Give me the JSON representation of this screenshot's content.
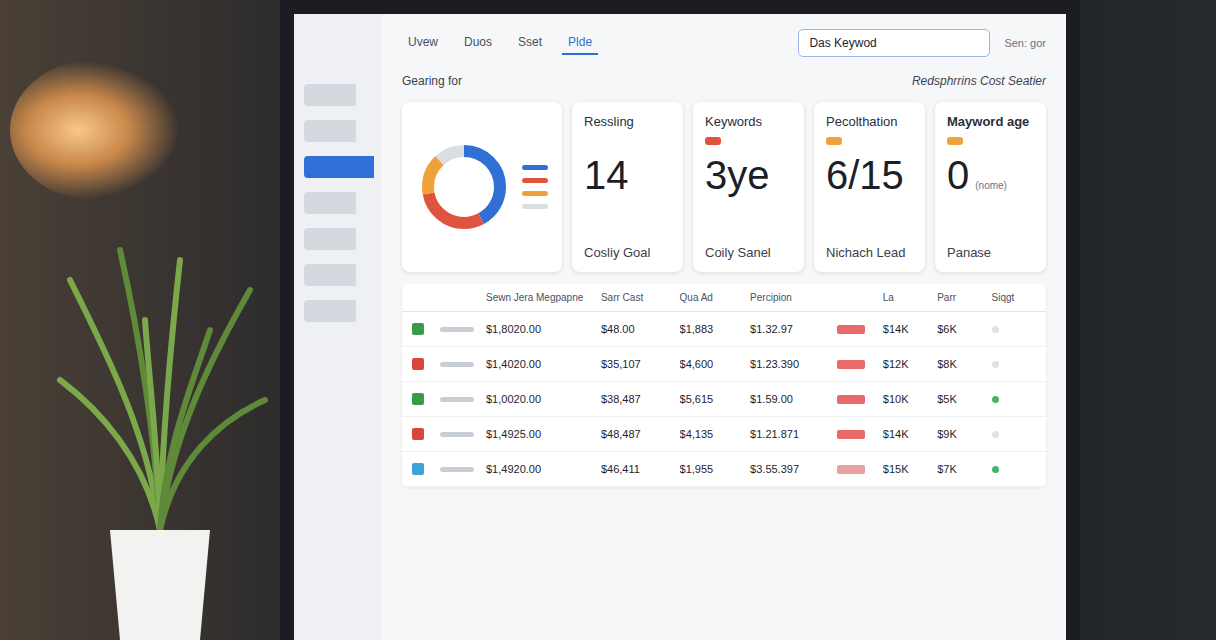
{
  "topbar": {
    "tabs": [
      {
        "label": "Uvew",
        "selected": false
      },
      {
        "label": "Duos",
        "selected": false
      },
      {
        "label": "Sset",
        "selected": false
      },
      {
        "label": "Plde",
        "selected": true
      }
    ],
    "search": {
      "value": "Das Keywod"
    },
    "status": "Sen: gor"
  },
  "sidebar": {
    "items": [
      {
        "selected": false
      },
      {
        "selected": false
      },
      {
        "selected": true
      },
      {
        "selected": false
      },
      {
        "selected": false
      },
      {
        "selected": false
      },
      {
        "selected": false
      }
    ]
  },
  "header": {
    "left": "Gearing for",
    "right": "Redsphrrins Cost Seatier"
  },
  "donut": {
    "segments": [
      {
        "value": 42,
        "color": "#2f6fd6"
      },
      {
        "value": 30,
        "color": "#e0533f"
      },
      {
        "value": 16,
        "color": "#f0a23a"
      },
      {
        "value": 12,
        "color": "#d9dde4"
      }
    ]
  },
  "cards": [
    {
      "title": "Ressling",
      "value": "14",
      "caption": "Cosliy Goal",
      "note": "",
      "marker_color": ""
    },
    {
      "title": "Keywords",
      "value": "3ye",
      "caption": "Coily Sanel",
      "note": "",
      "marker_color": "#e0533f"
    },
    {
      "title": "Pecolthation",
      "value": "6/15",
      "caption": "Nichach Lead",
      "note": "",
      "marker_color": "#f0a23a"
    },
    {
      "title": "Mayword age",
      "value": "0",
      "caption": "Panase",
      "note": "(nome)",
      "marker_color": "#f0a23a"
    }
  ],
  "table": {
    "columns": [
      "Sewn Jera Megpapne",
      "Sarr Cast",
      "Qua Ad",
      "Percipion",
      "La",
      "Parr",
      "Siqgt"
    ],
    "rows": [
      {
        "color": "#3a9a4a",
        "amount": "$1,8020.00",
        "cost": "$48.00",
        "qa": "$1,883",
        "perc": "$1.32.97",
        "flag_color": "#e86a6a",
        "la": "$14K",
        "parr": "$6K",
        "mark": false
      },
      {
        "color": "#d9463b",
        "amount": "$1,4020.00",
        "cost": "$35,107",
        "qa": "$4,600",
        "perc": "$1.23.390",
        "flag_color": "#e86a6a",
        "la": "$12K",
        "parr": "$8K",
        "mark": false
      },
      {
        "color": "#3a9a4a",
        "amount": "$1,0020.00",
        "cost": "$38,487",
        "qa": "$5,615",
        "perc": "$1.59.00",
        "flag_color": "#e86a6a",
        "la": "$10K",
        "parr": "$5K",
        "mark": true
      },
      {
        "color": "#d9463b",
        "amount": "$1,4925.00",
        "cost": "$48,487",
        "qa": "$4,135",
        "perc": "$1.21.871",
        "flag_color": "#e86a6a",
        "la": "$14K",
        "parr": "$9K",
        "mark": false
      },
      {
        "color": "#3aa3d9",
        "amount": "$1,4920.00",
        "cost": "$46,411",
        "qa": "$1,955",
        "perc": "$3.55.397",
        "flag_color": "#e8a0a0",
        "la": "$15K",
        "parr": "$7K",
        "mark": true
      }
    ]
  }
}
